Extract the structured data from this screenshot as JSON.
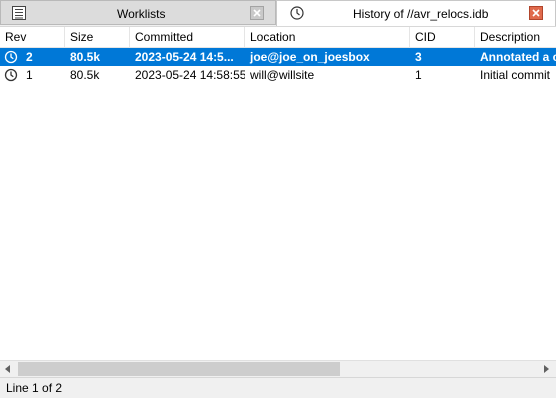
{
  "tabs": [
    {
      "label": "Worklists",
      "icon": "list-icon",
      "active": false
    },
    {
      "label": "History of //avr_relocs.idb",
      "icon": "clock-icon",
      "active": true
    }
  ],
  "columns": [
    "Rev",
    "Size",
    "Committed",
    "Location",
    "CID",
    "Description"
  ],
  "rows": [
    {
      "rev": "2",
      "size": "80.5k",
      "committed": "2023-05-24 14:5...",
      "location": "joe@joe_on_joesbox",
      "cid": "3",
      "description": "Annotated a c",
      "selected": true
    },
    {
      "rev": "1",
      "size": "80.5k",
      "committed": "2023-05-24 14:58:55",
      "location": "will@willsite",
      "cid": "1",
      "description": "Initial commit",
      "selected": false
    }
  ],
  "status": {
    "text": "Line 1 of 2"
  },
  "colors": {
    "selection": "#0078d7",
    "close_active": "#e06a4c"
  }
}
